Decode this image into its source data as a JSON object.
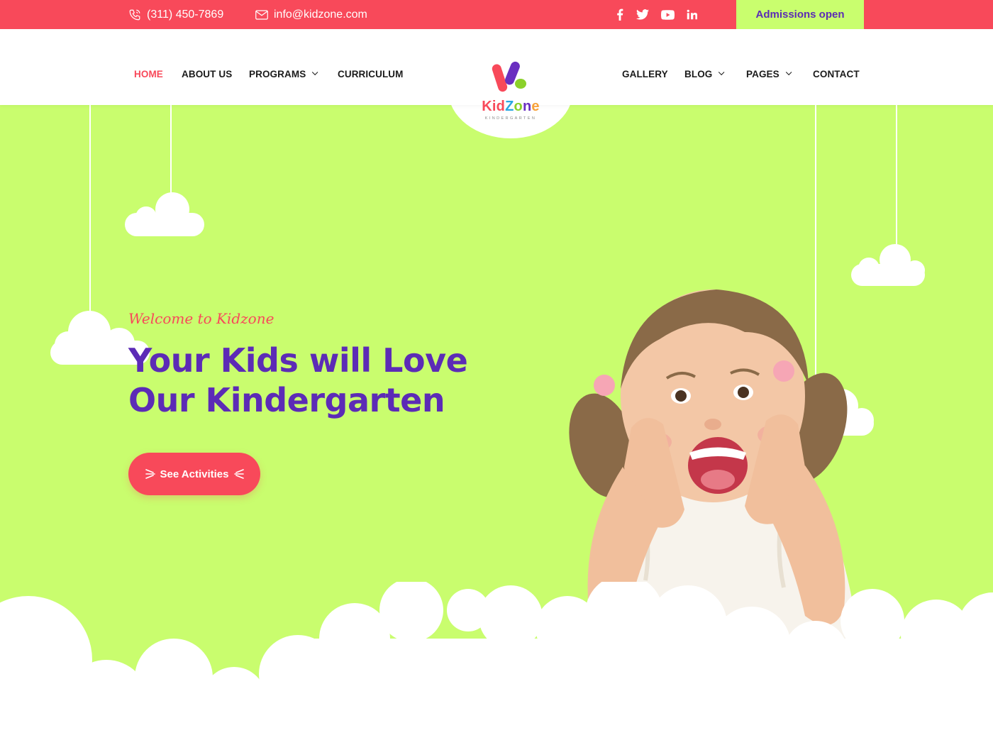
{
  "topbar": {
    "phone": "(311) 450-7869",
    "email": "info@kidzone.com",
    "social": [
      "facebook-icon",
      "twitter-icon",
      "youtube-icon",
      "linkedin-icon"
    ],
    "admissions": "Admissions open"
  },
  "nav": {
    "left": [
      {
        "label": "HOME",
        "active": true
      },
      {
        "label": "ABOUT US"
      },
      {
        "label": "PROGRAMS",
        "dropdown": true
      },
      {
        "label": "CURRICULUM"
      }
    ],
    "right": [
      {
        "label": "GALLERY"
      },
      {
        "label": "BLOG",
        "dropdown": true
      },
      {
        "label": "PAGES",
        "dropdown": true
      },
      {
        "label": "CONTACT"
      }
    ]
  },
  "logo": {
    "name_parts": [
      "Kid",
      "Z",
      "o",
      "n",
      "e"
    ],
    "subtitle": "KINDERGARTEN"
  },
  "hero": {
    "welcome": "Welcome to Kidzone",
    "headline_line1": "Your Kids will Love",
    "headline_line2": "Our Kindergarten",
    "cta": "See Activities"
  },
  "colors": {
    "primary": "#f8495a",
    "accent": "#c9fd6e",
    "purple": "#5c2bb6"
  }
}
